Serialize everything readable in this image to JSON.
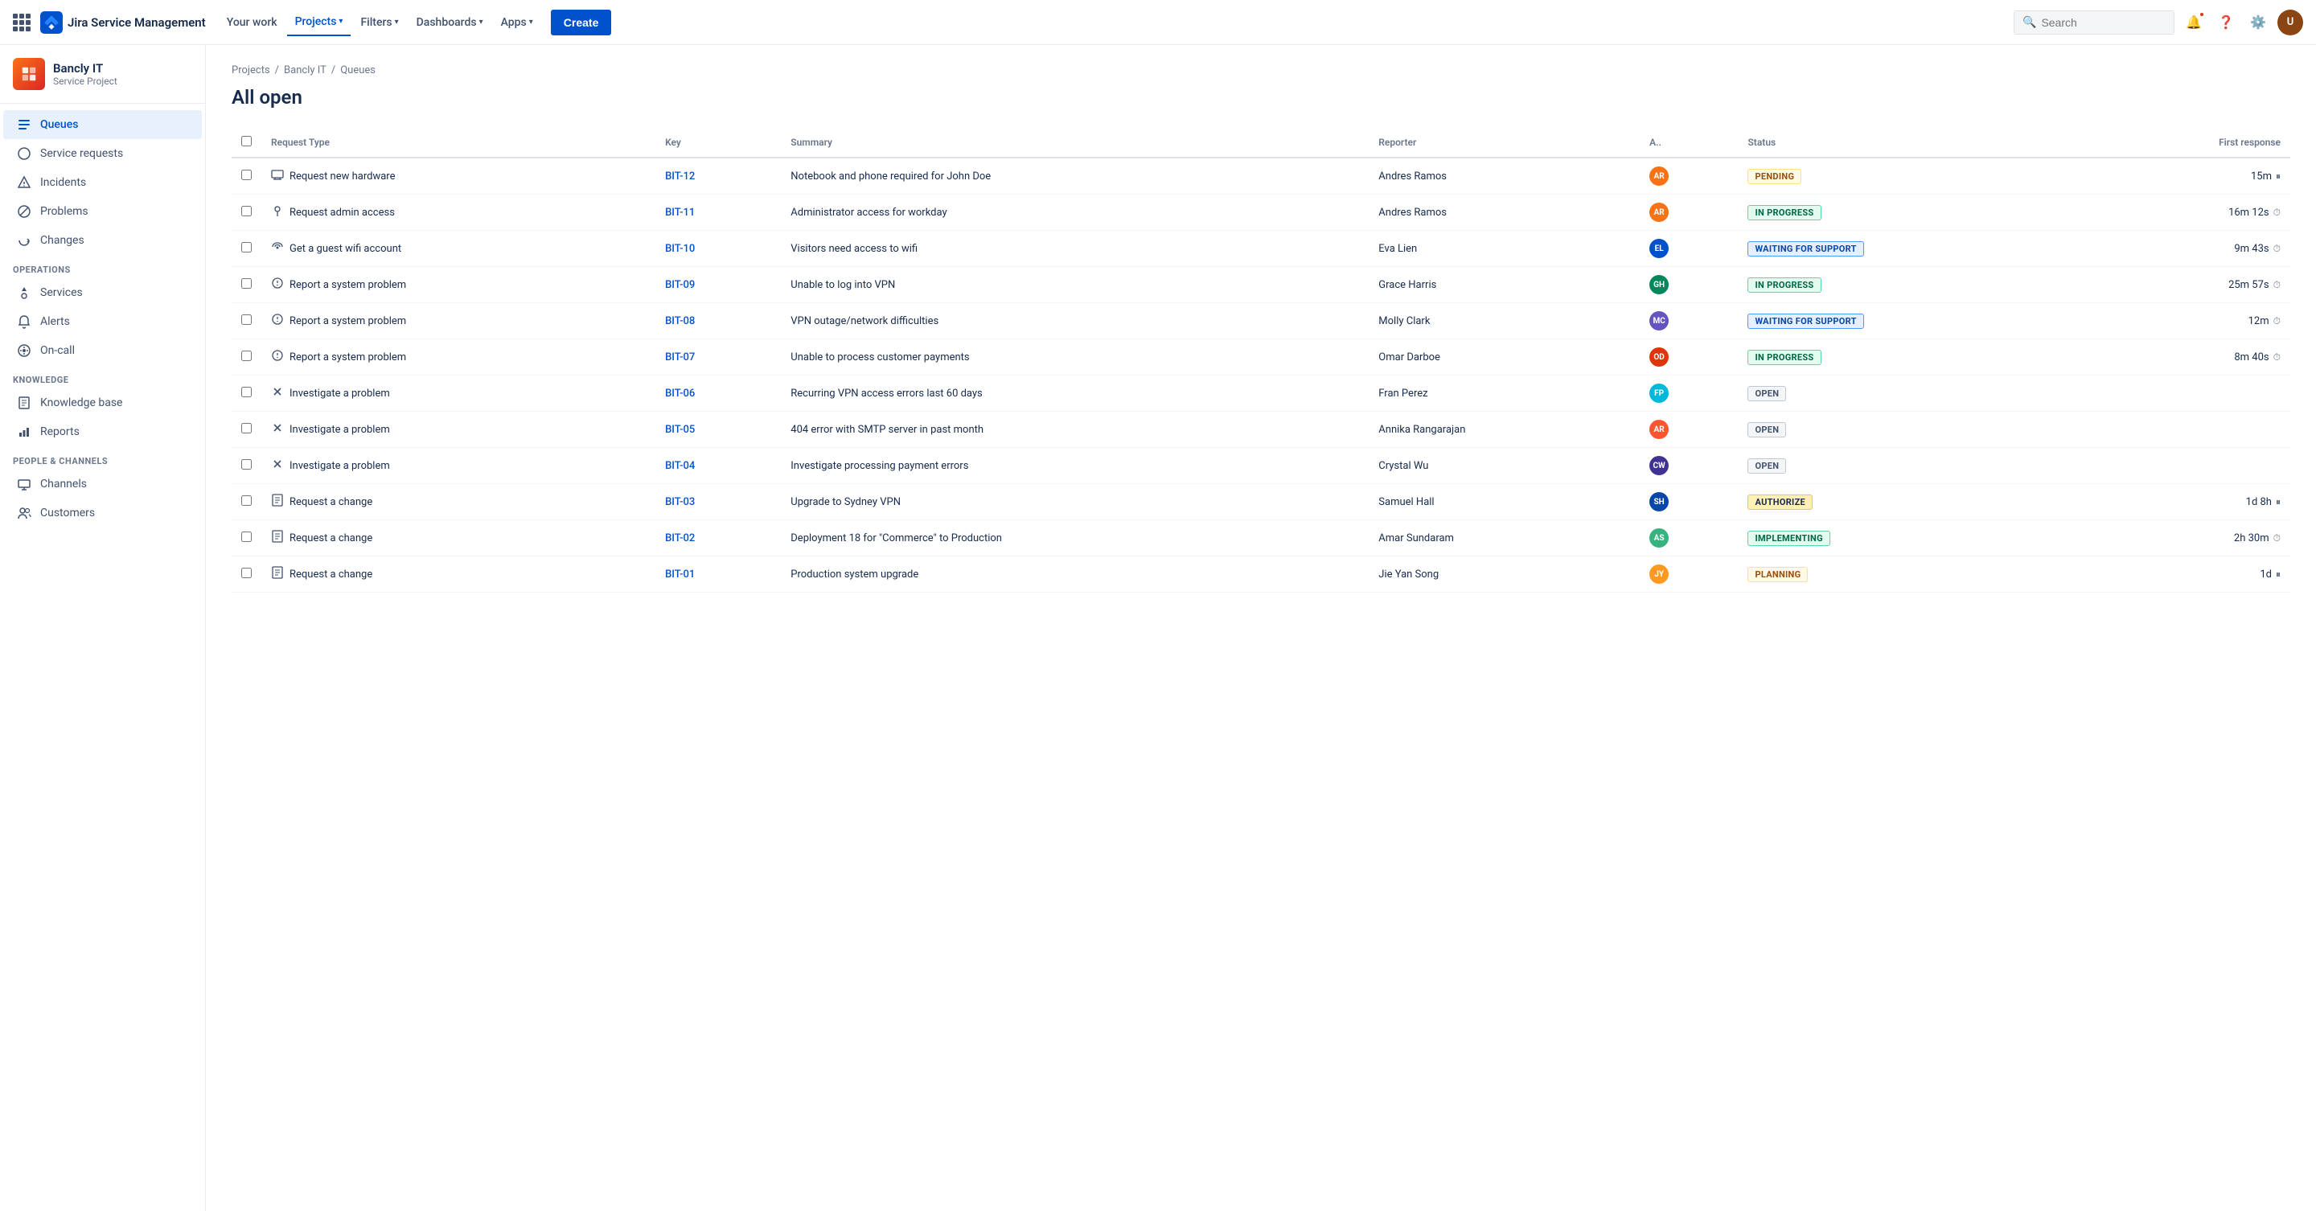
{
  "topnav": {
    "logo_text": "Jira Service Management",
    "links": [
      {
        "label": "Your work",
        "active": false,
        "has_dropdown": false
      },
      {
        "label": "Projects",
        "active": true,
        "has_dropdown": true
      },
      {
        "label": "Filters",
        "active": false,
        "has_dropdown": true
      },
      {
        "label": "Dashboards",
        "active": false,
        "has_dropdown": true
      },
      {
        "label": "Apps",
        "active": false,
        "has_dropdown": true
      }
    ],
    "create_label": "Create",
    "search_placeholder": "Search"
  },
  "sidebar": {
    "project_name": "Bancly IT",
    "project_type": "Service Project",
    "nav_items": [
      {
        "id": "queues",
        "label": "Queues",
        "icon": "≡",
        "active": true
      },
      {
        "id": "service-requests",
        "label": "Service requests",
        "icon": "○",
        "active": false
      },
      {
        "id": "incidents",
        "label": "Incidents",
        "icon": "△",
        "active": false
      },
      {
        "id": "problems",
        "label": "Problems",
        "icon": "⊘",
        "active": false
      },
      {
        "id": "changes",
        "label": "Changes",
        "icon": "↻",
        "active": false
      }
    ],
    "operations_section": "Operations",
    "operations_items": [
      {
        "id": "services",
        "label": "Services",
        "icon": "⬡",
        "active": false
      },
      {
        "id": "alerts",
        "label": "Alerts",
        "icon": "🔔",
        "active": false
      },
      {
        "id": "on-call",
        "label": "On-call",
        "icon": "⊕",
        "active": false
      }
    ],
    "knowledge_section": "Knowledge",
    "knowledge_items": [
      {
        "id": "knowledge-base",
        "label": "Knowledge base",
        "icon": "📄",
        "active": false
      },
      {
        "id": "reports",
        "label": "Reports",
        "icon": "📊",
        "active": false
      }
    ],
    "people_section": "People & Channels",
    "people_items": [
      {
        "id": "channels",
        "label": "Channels",
        "icon": "🖥",
        "active": false
      },
      {
        "id": "customers",
        "label": "Customers",
        "icon": "👥",
        "active": false
      }
    ]
  },
  "breadcrumb": [
    "Projects",
    "Bancly IT",
    "Queues"
  ],
  "page_title": "All open",
  "table": {
    "columns": [
      "",
      "Request Type",
      "Key",
      "Summary",
      "Reporter",
      "A..",
      "Status",
      "First response"
    ],
    "rows": [
      {
        "id": "bit-12",
        "req_icon": "🖥",
        "request_type": "Request new hardware",
        "key": "BIT-12",
        "summary": "Notebook and phone required for John Doe",
        "reporter": "Andres Ramos",
        "assignee_initials": "AR",
        "assignee_color": "av-orange",
        "status": "PENDING",
        "status_class": "status-pending",
        "first_response": "15m",
        "first_response_icon": "pause"
      },
      {
        "id": "bit-11",
        "req_icon": "🔑",
        "request_type": "Request admin access",
        "key": "BIT-11",
        "summary": "Administrator access for workday",
        "reporter": "Andres Ramos",
        "assignee_initials": "AR",
        "assignee_color": "av-orange",
        "status": "IN PROGRESS",
        "status_class": "status-in-progress",
        "first_response": "16m 12s",
        "first_response_icon": "clock"
      },
      {
        "id": "bit-10",
        "req_icon": "📶",
        "request_type": "Get a guest wifi account",
        "key": "BIT-10",
        "summary": "Visitors need access to wifi",
        "reporter": "Eva Lien",
        "assignee_initials": "EL",
        "assignee_color": "av-blue",
        "status": "WAITING FOR SUPPORT",
        "status_class": "status-waiting",
        "first_response": "9m 43s",
        "first_response_icon": "clock"
      },
      {
        "id": "bit-09",
        "req_icon": "⏱",
        "request_type": "Report a system problem",
        "key": "BIT-09",
        "summary": "Unable to log into VPN",
        "reporter": "Grace Harris",
        "assignee_initials": "GH",
        "assignee_color": "av-green",
        "status": "IN PROGRESS",
        "status_class": "status-in-progress",
        "first_response": "25m 57s",
        "first_response_icon": "clock"
      },
      {
        "id": "bit-08",
        "req_icon": "⏱",
        "request_type": "Report a system problem",
        "key": "BIT-08",
        "summary": "VPN outage/network difficulties",
        "reporter": "Molly Clark",
        "assignee_initials": "MC",
        "assignee_color": "av-purple",
        "status": "WAITING FOR SUPPORT",
        "status_class": "status-waiting",
        "first_response": "12m",
        "first_response_icon": "clock"
      },
      {
        "id": "bit-07",
        "req_icon": "⏱",
        "request_type": "Report a system problem",
        "key": "BIT-07",
        "summary": "Unable to process customer payments",
        "reporter": "Omar Darboe",
        "assignee_initials": "OD",
        "assignee_color": "av-red",
        "status": "IN PROGRESS",
        "status_class": "status-in-progress",
        "first_response": "8m 40s",
        "first_response_icon": "clock"
      },
      {
        "id": "bit-06",
        "req_icon": "✂",
        "request_type": "Investigate a problem",
        "key": "BIT-06",
        "summary": "Recurring VPN access errors last 60 days",
        "reporter": "Fran Perez",
        "assignee_initials": "FP",
        "assignee_color": "av-teal",
        "status": "OPEN",
        "status_class": "status-open",
        "first_response": "",
        "first_response_icon": ""
      },
      {
        "id": "bit-05",
        "req_icon": "✂",
        "request_type": "Investigate a problem",
        "key": "BIT-05",
        "summary": "404 error with SMTP server in past month",
        "reporter": "Annika Rangarajan",
        "assignee_initials": "AR",
        "assignee_color": "av-pink",
        "status": "OPEN",
        "status_class": "status-open",
        "first_response": "",
        "first_response_icon": ""
      },
      {
        "id": "bit-04",
        "req_icon": "✂",
        "request_type": "Investigate a problem",
        "key": "BIT-04",
        "summary": "Investigate processing payment errors",
        "reporter": "Crystal Wu",
        "assignee_initials": "CW",
        "assignee_color": "av-indigo",
        "status": "OPEN",
        "status_class": "status-open",
        "first_response": "",
        "first_response_icon": ""
      },
      {
        "id": "bit-03",
        "req_icon": "📋",
        "request_type": "Request a change",
        "key": "BIT-03",
        "summary": "Upgrade to Sydney VPN",
        "reporter": "Samuel Hall",
        "assignee_initials": "SH",
        "assignee_color": "av-navy",
        "status": "AUTHORIZE",
        "status_class": "status-authorize",
        "first_response": "1d 8h",
        "first_response_icon": "pause"
      },
      {
        "id": "bit-02",
        "req_icon": "📋",
        "request_type": "Request a change",
        "key": "BIT-02",
        "summary": "Deployment 18 for \"Commerce\" to Production",
        "reporter": "Amar Sundaram",
        "assignee_initials": "AS",
        "assignee_color": "av-lime",
        "status": "IMPLEMENTING",
        "status_class": "status-implementing",
        "first_response": "2h 30m",
        "first_response_icon": "clock"
      },
      {
        "id": "bit-01",
        "req_icon": "📋",
        "request_type": "Request a change",
        "key": "BIT-01",
        "summary": "Production system upgrade",
        "reporter": "Jie Yan Song",
        "assignee_initials": "JY",
        "assignee_color": "av-yellow",
        "status": "PLANNING",
        "status_class": "status-planning",
        "first_response": "1d",
        "first_response_icon": "pause"
      }
    ]
  }
}
